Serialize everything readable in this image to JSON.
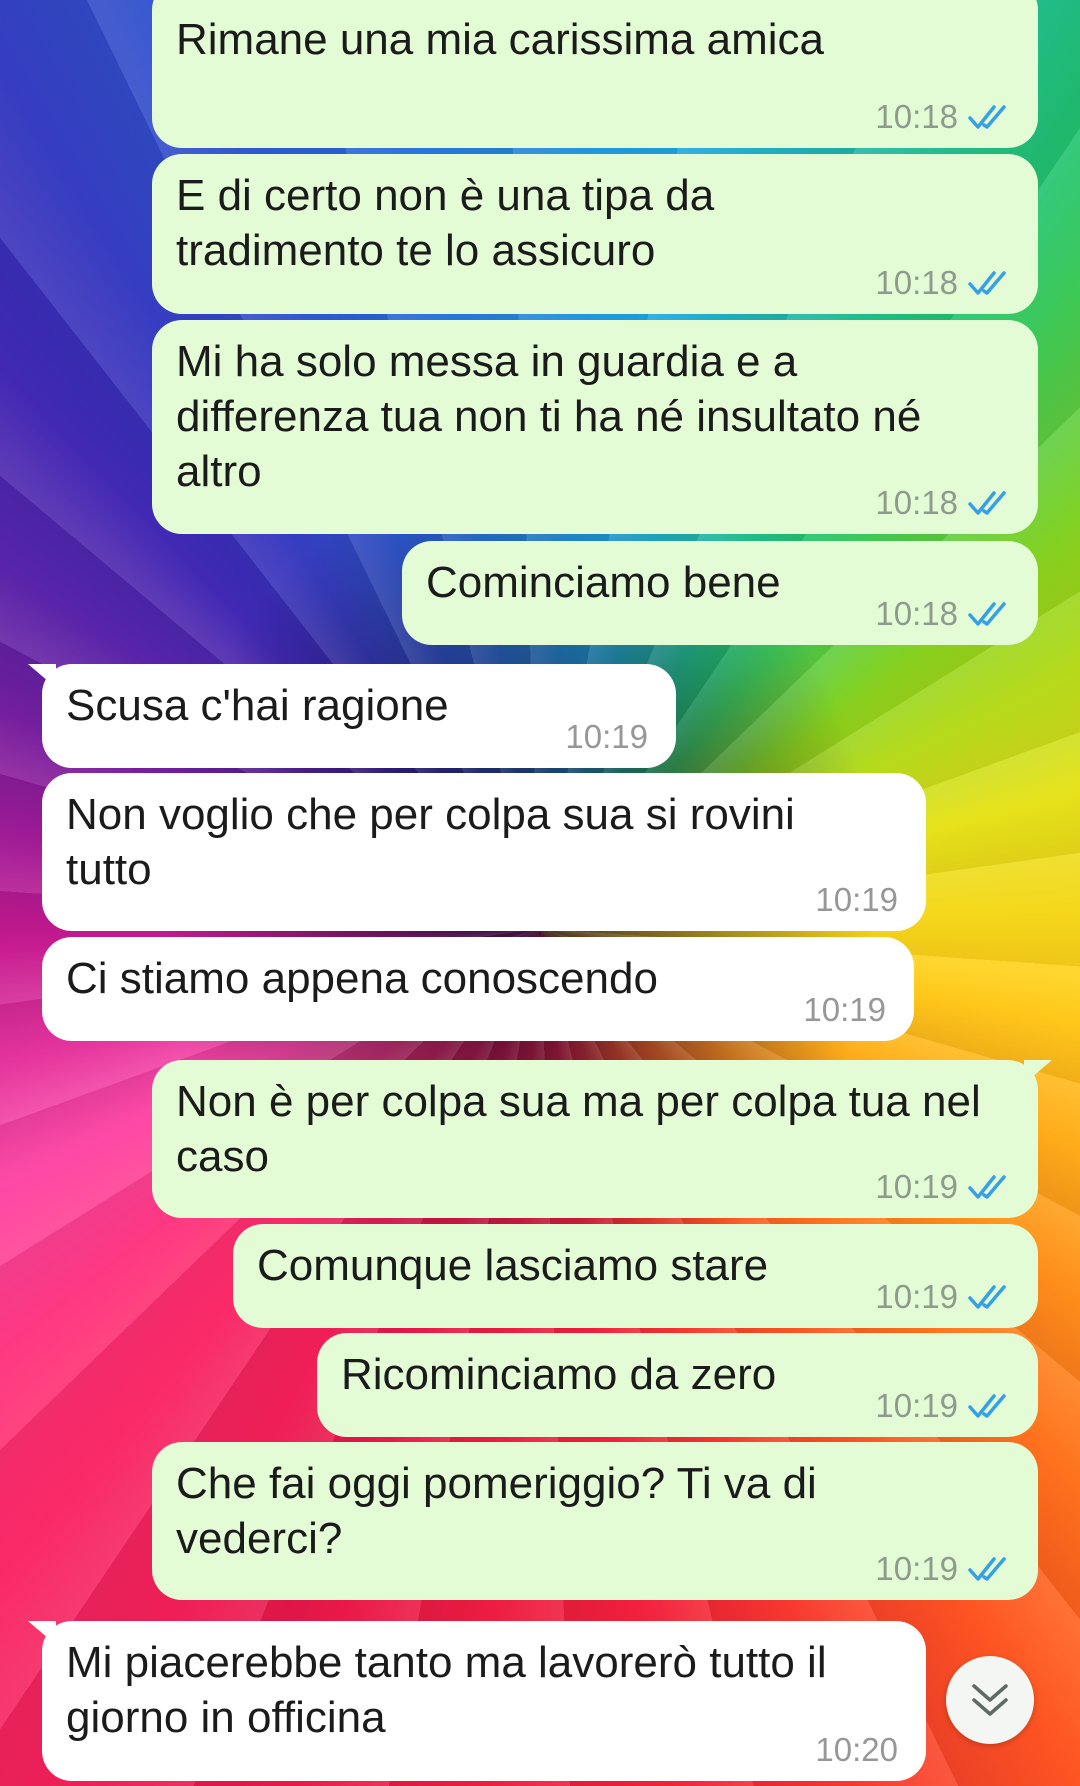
{
  "colors": {
    "outgoing_bubble": "#e4fcd6",
    "incoming_bubble": "#ffffff",
    "read_ticks": "#35a0e6"
  },
  "messages": [
    {
      "direction": "out",
      "text": "Rimane una mia carissima amica",
      "time": "10:18",
      "status": "read"
    },
    {
      "direction": "out",
      "text": "E di certo non è una tipa da tradimento te lo assicuro",
      "time": "10:18",
      "status": "read"
    },
    {
      "direction": "out",
      "text": "Mi ha solo messa in guardia e a differenza tua non ti ha né insultato né altro",
      "time": "10:18",
      "status": "read"
    },
    {
      "direction": "out",
      "text": "Cominciamo bene",
      "time": "10:18",
      "status": "read"
    },
    {
      "direction": "in",
      "text": "Scusa c'hai ragione",
      "time": "10:19"
    },
    {
      "direction": "in",
      "text": "Non voglio che per colpa sua si rovini tutto",
      "time": "10:19"
    },
    {
      "direction": "in",
      "text": "Ci stiamo appena conoscendo",
      "time": "10:19"
    },
    {
      "direction": "out",
      "text": "Non è per colpa sua ma per colpa tua nel caso",
      "time": "10:19",
      "status": "read"
    },
    {
      "direction": "out",
      "text": "Comunque lasciamo stare",
      "time": "10:19",
      "status": "read"
    },
    {
      "direction": "out",
      "text": "Ricominciamo da zero",
      "time": "10:19",
      "status": "read"
    },
    {
      "direction": "out",
      "text": "Che fai oggi pomeriggio? Ti va di vederci?",
      "time": "10:19",
      "status": "read"
    },
    {
      "direction": "in",
      "text": "Mi piacerebbe tanto ma lavorerò tutto il giorno in officina",
      "time": "10:20"
    }
  ],
  "scroll_button_icon": "double-chevron-down-icon"
}
